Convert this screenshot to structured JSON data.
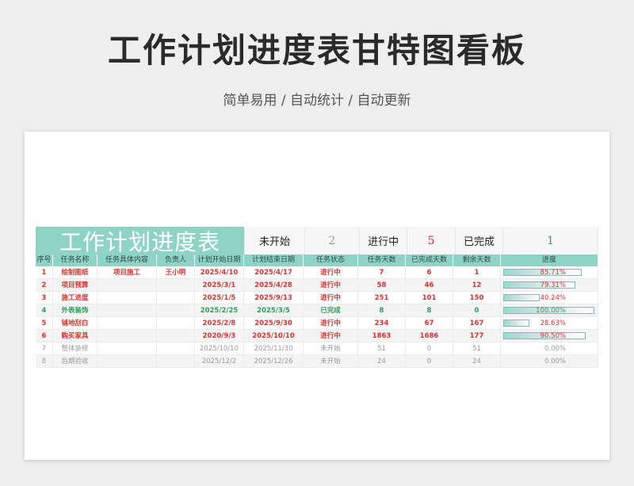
{
  "header": {
    "title": "工作计划进度表甘特图看板",
    "subtitle": "简单易用 / 自动统计 / 自动更新"
  },
  "sheet": {
    "banner": "工作计划进度表",
    "summary": [
      {
        "label": "未开始",
        "count": "2",
        "color": "#999999"
      },
      {
        "label": "进行中",
        "count": "5",
        "color": "#e03131"
      },
      {
        "label": "已完成",
        "count": "1",
        "color": "#2e9e5b"
      }
    ],
    "columns": [
      "序号",
      "任务名称",
      "任务具体内容",
      "负责人",
      "计划开始日期",
      "计划结束日期",
      "任务状态",
      "任务天数",
      "已完成天数",
      "剩余天数",
      "进度"
    ],
    "rows": [
      {
        "no": "1",
        "name": "绘制图纸",
        "detail": "项目施工",
        "owner": "王小明",
        "start": "2025/4/10",
        "end": "2025/4/17",
        "status": "进行中",
        "days": "7",
        "done": "6",
        "left": "1",
        "progress": "85.71%",
        "pct": 0.8571,
        "color": "#e03131",
        "bold": true
      },
      {
        "no": "2",
        "name": "项目预算",
        "detail": "",
        "owner": "",
        "start": "2025/3/1",
        "end": "2025/4/28",
        "status": "进行中",
        "days": "58",
        "done": "46",
        "left": "12",
        "progress": "79.31%",
        "pct": 0.7931,
        "color": "#e03131",
        "bold": true
      },
      {
        "no": "3",
        "name": "施工进度",
        "detail": "",
        "owner": "",
        "start": "2025/1/5",
        "end": "2025/9/13",
        "status": "进行中",
        "days": "251",
        "done": "101",
        "left": "150",
        "progress": "40.24%",
        "pct": 0.4024,
        "color": "#e03131",
        "bold": true
      },
      {
        "no": "4",
        "name": "外表装饰",
        "detail": "",
        "owner": "",
        "start": "2025/2/25",
        "end": "2025/3/5",
        "status": "已完成",
        "days": "8",
        "done": "8",
        "left": "0",
        "progress": "100.00%",
        "pct": 1.0,
        "color": "#2e9e5b",
        "bold": true
      },
      {
        "no": "5",
        "name": "铺地刮白",
        "detail": "",
        "owner": "",
        "start": "2025/2/8",
        "end": "2025/9/30",
        "status": "进行中",
        "days": "234",
        "done": "67",
        "left": "167",
        "progress": "28.63%",
        "pct": 0.2863,
        "color": "#e03131",
        "bold": true
      },
      {
        "no": "6",
        "name": "购买家具",
        "detail": "",
        "owner": "",
        "start": "2020/9/3",
        "end": "2025/10/10",
        "status": "进行中",
        "days": "1863",
        "done": "1686",
        "left": "177",
        "progress": "90.50%",
        "pct": 0.905,
        "color": "#e03131",
        "bold": true
      },
      {
        "no": "7",
        "name": "整体装修",
        "detail": "",
        "owner": "",
        "start": "2025/10/10",
        "end": "2025/11/30",
        "status": "未开始",
        "days": "51",
        "done": "0",
        "left": "51",
        "progress": "0.00%",
        "pct": 0,
        "color": "#999999",
        "bold": false
      },
      {
        "no": "8",
        "name": "后期验收",
        "detail": "",
        "owner": "",
        "start": "2025/12/2",
        "end": "2025/12/26",
        "status": "未开始",
        "days": "24",
        "done": "0",
        "left": "24",
        "progress": "0.00%",
        "pct": 0,
        "color": "#999999",
        "bold": false
      }
    ]
  }
}
